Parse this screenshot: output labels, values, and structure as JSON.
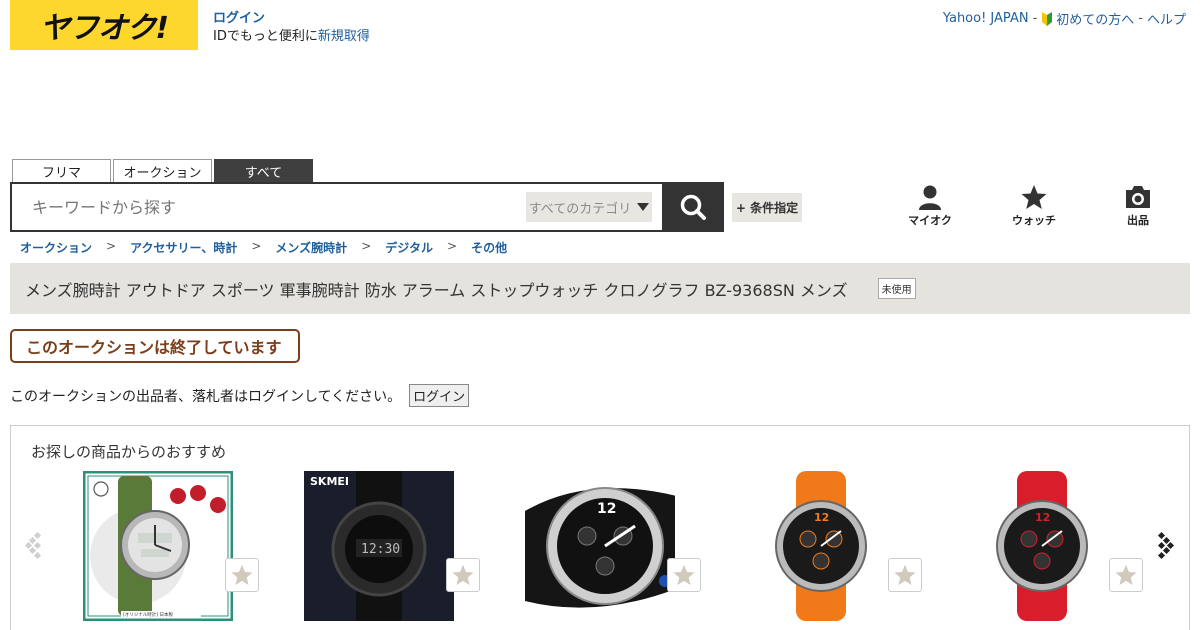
{
  "header": {
    "logo_text": "ヤフオク!",
    "login_label": "ログイン",
    "register_prefix": "IDでもっと便利に",
    "register_link": "新規取得",
    "top_links": [
      "Yahoo! JAPAN",
      "初めての方へ",
      "ヘルプ"
    ],
    "top_link_sep": "-"
  },
  "search": {
    "tabs": [
      "フリマ",
      "オークション",
      "すべて"
    ],
    "active_tab": "すべて",
    "placeholder": "キーワードから探す",
    "category_label": "すべてのカテゴリ",
    "condition_label": "+ 条件指定"
  },
  "nav": {
    "myauction": "マイオク",
    "watch": "ウォッチ",
    "sell": "出品"
  },
  "breadcrumb": [
    "オークション",
    "アクセサリー、時計",
    "メンズ腕時計",
    "デジタル",
    "その他"
  ],
  "breadcrumb_sep": ">",
  "item": {
    "title": "メンズ腕時計 アウトドア スポーツ 軍事腕時計 防水 アラーム ストップウォッチ クロノグラフ BZ-9368SN メンズ",
    "condition_badge": "未使用",
    "status_text": "このオークションは終了しています",
    "login_notice": "このオークションの出品者、落札者はログインしてください。",
    "login_button": "ログイン"
  },
  "recommendations": {
    "heading": "お探しの商品からのおすすめ",
    "thumbnails": [
      {
        "icon": "green-strap-analog-digital-watch",
        "strap": "#5a7a3a",
        "face": "#d8d8d8"
      },
      {
        "icon": "black-digital-sports-watch",
        "brand": "SKMEI",
        "strap": "#222222",
        "face": "#111111"
      },
      {
        "icon": "silver-black-chronograph-watch",
        "strap": "#111111",
        "face": "#111111"
      },
      {
        "icon": "orange-chronograph-watch",
        "strap": "#f07a1a",
        "face": "#1a1a1a"
      },
      {
        "icon": "red-chronograph-watch",
        "strap": "#d81e2a",
        "face": "#1a1a1a"
      }
    ]
  },
  "colors": {
    "brand_yellow": "#fdd72d",
    "link_blue": "#1f5f9e",
    "ended_brown": "#7a3f1a"
  }
}
